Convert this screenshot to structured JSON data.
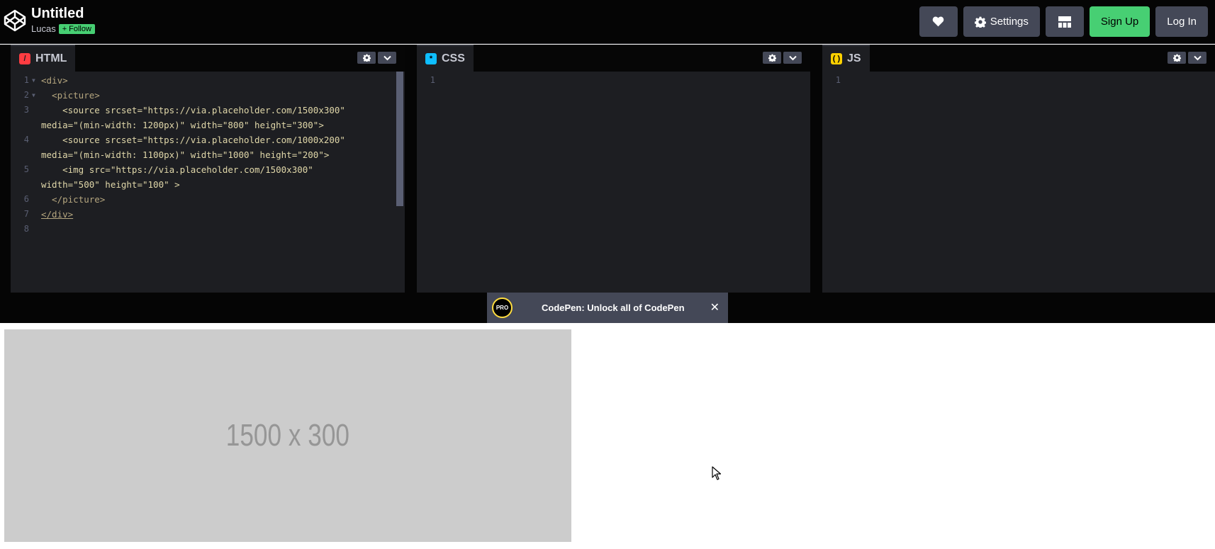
{
  "header": {
    "pen_title": "Untitled",
    "owner": "Lucas",
    "follow_label": "Follow",
    "buttons": {
      "like_icon": "heart-icon",
      "settings_label": "Settings",
      "settings_icon": "gear-icon",
      "layout_icon": "layout-grid-icon",
      "signup_label": "Sign Up",
      "login_label": "Log In"
    }
  },
  "editors": [
    {
      "label": "HTML",
      "icon": "html-icon",
      "icon_color": "#ff3c41",
      "line_numbers": [
        "1",
        "2",
        "3",
        "",
        "4",
        "",
        "5",
        "",
        "6",
        "7",
        "8"
      ],
      "code_lines": [
        "<div>",
        "  <picture>",
        "    <source srcset=\"https://via.placeholder.com/1500x300\"",
        "media=\"(min-width: 1200px)\" width=\"800\" height=\"300\">",
        "    <source srcset=\"https://via.placeholder.com/1000x200\"",
        "media=\"(min-width: 1100px)\" width=\"1000\" height=\"200\">",
        "    <img src=\"https://via.placeholder.com/1500x300\"",
        "width=\"500\" height=\"100\" >",
        "  </picture>",
        "</div>",
        ""
      ]
    },
    {
      "label": "CSS",
      "icon": "css-icon",
      "icon_color": "#0ebeff",
      "line_numbers": [
        "1"
      ],
      "code_lines": [
        ""
      ]
    },
    {
      "label": "JS",
      "icon": "js-icon",
      "icon_color": "#fcd000",
      "line_numbers": [
        "1"
      ],
      "code_lines": [
        ""
      ]
    }
  ],
  "pro_banner": {
    "badge": "PRO",
    "text": "CodePen: Unlock all of CodePen",
    "close": "✕"
  },
  "preview": {
    "image_text": "1500 x 300"
  },
  "colors": {
    "accent_green": "#47cf73",
    "button_gray": "#444857",
    "editor_bg": "#1d1e22"
  }
}
